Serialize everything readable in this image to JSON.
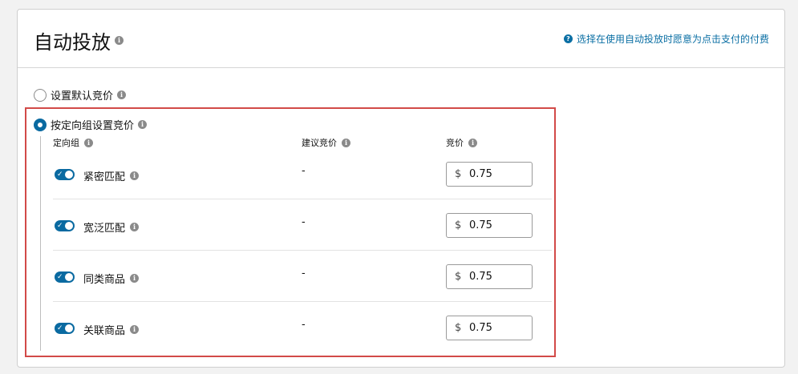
{
  "header": {
    "title": "自动投放",
    "help_text": "选择在使用自动投放时愿意为点击支付的付费"
  },
  "options": {
    "default_bid_label": "设置默认竞价",
    "targeting_bid_label": "按定向组设置竞价"
  },
  "columns": {
    "group": "定向组",
    "suggested": "建议竞价",
    "bid": "竞价"
  },
  "rows": [
    {
      "name": "紧密匹配",
      "suggested": "-",
      "currency": "$",
      "bid": "0.75",
      "enabled": true
    },
    {
      "name": "宽泛匹配",
      "suggested": "-",
      "currency": "$",
      "bid": "0.75",
      "enabled": true
    },
    {
      "name": "同类商品",
      "suggested": "-",
      "currency": "$",
      "bid": "0.75",
      "enabled": true
    },
    {
      "name": "关联商品",
      "suggested": "-",
      "currency": "$",
      "bid": "0.75",
      "enabled": true
    }
  ],
  "colors": {
    "accent": "#0a6aa1",
    "link": "#0b6fa4",
    "highlight": "#d24a48"
  },
  "icons": {
    "info": "info-icon",
    "help": "question-circle-icon",
    "toggle_on": "check-icon"
  }
}
